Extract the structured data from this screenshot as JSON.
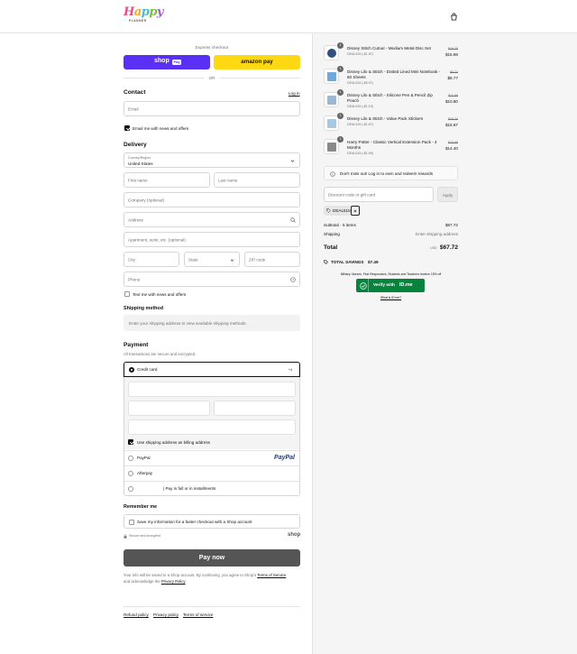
{
  "header": {
    "logo_text": "Happy",
    "logo_sub": "PLANNER",
    "cart_icon": "bag-icon"
  },
  "express": {
    "title": "Express checkout",
    "shop_pay": "shop",
    "shop_pay_badge": "Pay",
    "amazon_pay": "amazon pay",
    "or": "OR"
  },
  "contact": {
    "title": "Contact",
    "login": "Log in",
    "email_placeholder": "Email",
    "news_label": "Email me with news and offers",
    "news_checked": true
  },
  "delivery": {
    "title": "Delivery",
    "country_label": "Country/Region",
    "country_value": "United States",
    "first_name": "First name",
    "last_name": "Last name",
    "company": "Company (optional)",
    "address": "Address",
    "apartment": "Apartment, suite, etc. (optional)",
    "city": "City",
    "state": "State",
    "zip": "ZIP code",
    "phone": "Phone",
    "sms_label": "Text me with news and offers"
  },
  "shipping": {
    "title": "Shipping method",
    "notice": "Enter your shipping address to view available shipping methods."
  },
  "payment": {
    "title": "Payment",
    "subtitle": "All transactions are secure and encrypted.",
    "credit_card": "Credit card",
    "card_more": "+4",
    "billing_label": "Use shipping address as billing address",
    "paypal": "PayPal",
    "paypal_logo": "PayPal",
    "afterpay": "Afterpay",
    "installments": "| Pay in full or in installments"
  },
  "remember": {
    "title": "Remember me",
    "label": "Save my information for a faster checkout with a Shop account",
    "secure": "Secure and encrypted",
    "shop": "shop"
  },
  "pay_now": "Pay now",
  "legal": {
    "text1": "Your info will be saved to a Shop account. By continuing, you agree to Shop's ",
    "terms": "Terms of Service",
    "text2": "and acknowledge the ",
    "privacy": "Privacy Policy"
  },
  "footer_links": [
    "Refund policy",
    "Privacy policy",
    "Terms of service"
  ],
  "order": {
    "items": [
      {
        "qty": "1",
        "name": "Disney Stitch Cutout - Medium Metal Disc Set",
        "discount": "DEAL515 (-$1.87)",
        "compare": "$18.75",
        "price": "$16.88"
      },
      {
        "qty": "1",
        "name": "Disney Lilo & Stitch - Dotted Lined Mini Notebook - 60 Sheets",
        "discount": "DEAL515 (-$0.97)",
        "compare": "$9.74",
        "price": "$8.77"
      },
      {
        "qty": "1",
        "name": "Disney Lilo & Stitch - Silicone Pen & Pencil Zip Pouch",
        "discount": "DEAL515 (-$1.19)",
        "compare": "$11.99",
        "price": "$10.80"
      },
      {
        "qty": "1",
        "name": "Disney Lilo & Stitch - Value Pack Stickers",
        "discount": "DEAL515 (-$1.87)",
        "compare": "$18.74",
        "price": "$16.87"
      },
      {
        "qty": "1",
        "name": "Harry Potter - Classic Vertical Extension Pack - 4 Months",
        "discount": "DEAL515 (-$1.59)",
        "compare": "$15.99",
        "price": "$14.40"
      }
    ],
    "rewards": "Don't miss out! Log in to earn and redeem rewards",
    "rewards_link": "Log in",
    "discount_placeholder": "Discount code or gift card",
    "apply": "Apply",
    "code_tag": "DEAL515",
    "subtotal_label": "Subtotal · 5 items",
    "subtotal_value": "$67.72",
    "shipping_label": "Shipping",
    "shipping_value": "Enter shipping address",
    "total_label": "Total",
    "currency": "USD",
    "total_value": "$67.72",
    "savings_label": "TOTAL SAVINGS",
    "savings_value": "$7.49",
    "idme_note": "Military, Nurses, First Responders, Students and Teachers receive 15% off",
    "idme_button": "Verify with",
    "idme_brand": "ID.me",
    "idme_link": "What is ID.me?"
  },
  "colors": {
    "shop_pay": "#5a31f4",
    "amazon": "#ffd814",
    "pay_now": "#555555",
    "idme": "#08833d"
  }
}
